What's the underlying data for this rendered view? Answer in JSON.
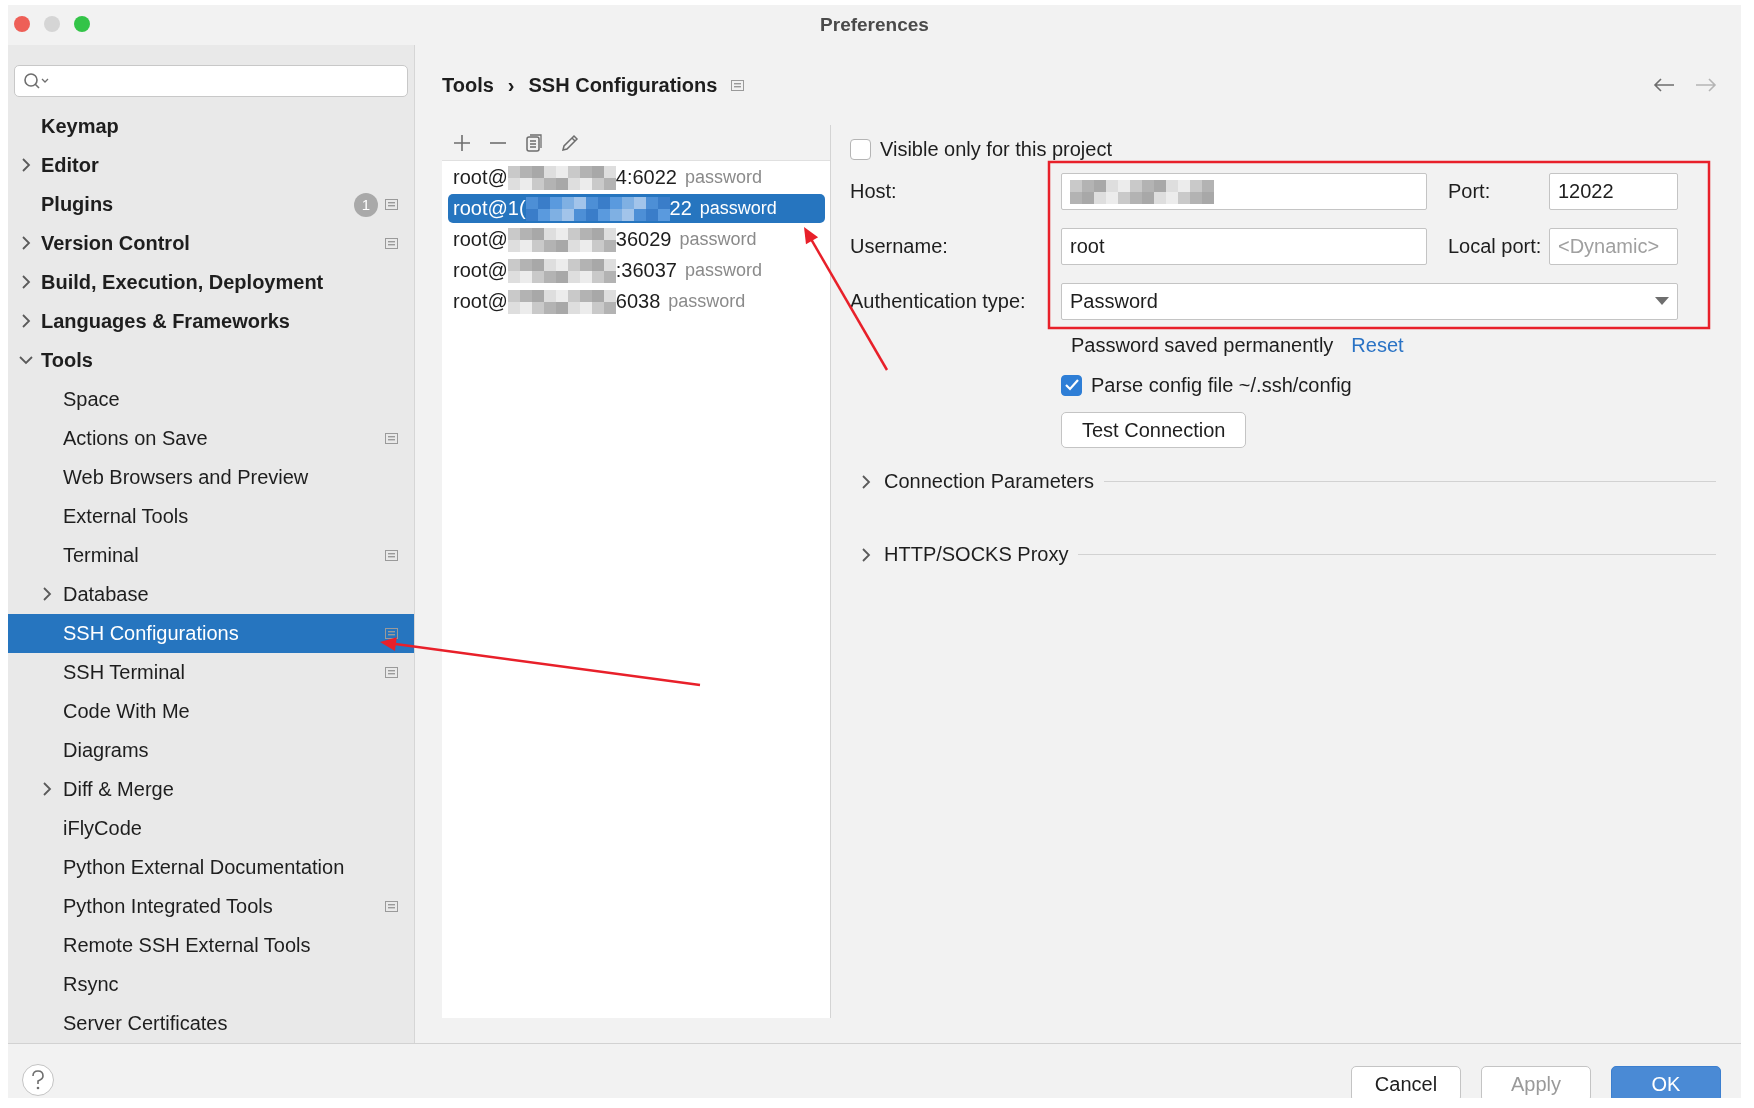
{
  "window": {
    "title": "Preferences"
  },
  "sidebar": {
    "items": [
      {
        "label": "Keymap",
        "project_level": false,
        "selected": false
      },
      {
        "label": "Editor",
        "expanded": false,
        "project_level": false,
        "selected": false
      },
      {
        "label": "Plugins",
        "project_level": true,
        "badge": "1",
        "selected": false
      },
      {
        "label": "Version Control",
        "expanded": false,
        "project_level": true,
        "selected": false
      },
      {
        "label": "Build, Execution, Deployment",
        "expanded": false,
        "project_level": false,
        "selected": false
      },
      {
        "label": "Languages & Frameworks",
        "expanded": false,
        "project_level": false,
        "selected": false
      },
      {
        "label": "Tools",
        "expanded": true,
        "project_level": false,
        "selected": false,
        "children": [
          {
            "label": "Space",
            "project_level": false,
            "selected": false
          },
          {
            "label": "Actions on Save",
            "project_level": true,
            "selected": false
          },
          {
            "label": "Web Browsers and Preview",
            "project_level": false,
            "selected": false
          },
          {
            "label": "External Tools",
            "project_level": false,
            "selected": false
          },
          {
            "label": "Terminal",
            "project_level": true,
            "selected": false
          },
          {
            "label": "Database",
            "expanded": false,
            "project_level": false,
            "selected": false
          },
          {
            "label": "SSH Configurations",
            "project_level": true,
            "selected": true
          },
          {
            "label": "SSH Terminal",
            "project_level": true,
            "selected": false
          },
          {
            "label": "Code With Me",
            "project_level": false,
            "selected": false
          },
          {
            "label": "Diagrams",
            "project_level": false,
            "selected": false
          },
          {
            "label": "Diff & Merge",
            "expanded": false,
            "project_level": false,
            "selected": false
          },
          {
            "label": "iFlyCode",
            "project_level": false,
            "selected": false
          },
          {
            "label": "Python External Documentation",
            "project_level": false,
            "selected": false
          },
          {
            "label": "Python Integrated Tools",
            "project_level": true,
            "selected": false
          },
          {
            "label": "Remote SSH External Tools",
            "project_level": false,
            "selected": false
          },
          {
            "label": "Rsync",
            "project_level": false,
            "selected": false
          },
          {
            "label": "Server Certificates",
            "project_level": false,
            "selected": false
          }
        ]
      }
    ]
  },
  "breadcrumb": {
    "items": [
      "Tools",
      "SSH Configurations"
    ],
    "separator": "›",
    "project_level": true
  },
  "configurations": [
    {
      "prefix": "root@",
      "suffix": "4:6022",
      "auth": "password",
      "redacted": true,
      "selected": false
    },
    {
      "prefix": "root@1(",
      "suffix": "22",
      "auth": "password",
      "redacted": true,
      "selected": true
    },
    {
      "prefix": "root@",
      "suffix": "36029",
      "auth": "password",
      "redacted": true,
      "selected": false
    },
    {
      "prefix": "root@",
      "suffix": ":36037",
      "auth": "password",
      "redacted": true,
      "selected": false
    },
    {
      "prefix": "root@",
      "suffix": "6038",
      "auth": "password",
      "redacted": true,
      "selected": false
    }
  ],
  "form": {
    "visible_only": {
      "label": "Visible only for this project",
      "checked": false
    },
    "host": {
      "label": "Host:",
      "redacted": true
    },
    "port": {
      "label": "Port:",
      "value": "12022"
    },
    "username": {
      "label": "Username:",
      "value": "root"
    },
    "local_port": {
      "label": "Local port:",
      "placeholder": "<Dynamic>"
    },
    "auth_type": {
      "label": "Authentication type:",
      "value": "Password"
    },
    "password_note": "Password saved permanently",
    "reset_link": "Reset",
    "parse_config": {
      "label": "Parse config file ~/.ssh/config",
      "checked": true
    },
    "test_button": "Test Connection",
    "sections": [
      {
        "label": "Connection Parameters",
        "expanded": false
      },
      {
        "label": "HTTP/SOCKS Proxy",
        "expanded": false
      }
    ]
  },
  "buttons": [
    {
      "label": "Cancel",
      "kind": "normal"
    },
    {
      "label": "Apply",
      "kind": "disabled"
    },
    {
      "label": "OK",
      "kind": "primary"
    }
  ],
  "annotations": [
    {
      "kind": "frame"
    },
    {
      "kind": "arrow"
    },
    {
      "kind": "arrow"
    }
  ]
}
